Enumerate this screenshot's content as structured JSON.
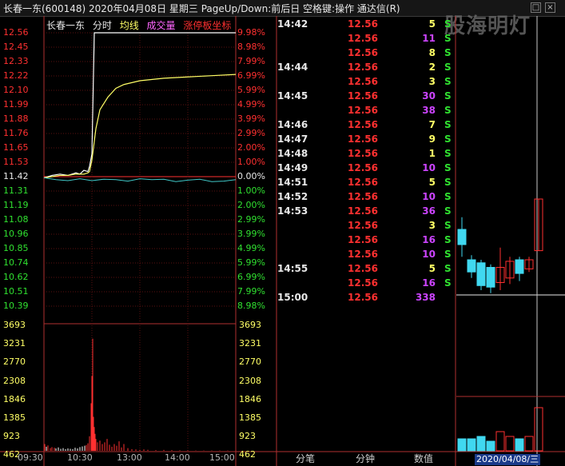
{
  "window": {
    "title": "长春一东(600148)  2020年04月08日 星期三  PageUp/Down:前后日  空格键:操作  通达信(R)",
    "min_glyph": "□",
    "close_glyph": "×"
  },
  "watermark": "股海明灯",
  "chart_header": {
    "name": "长春一东",
    "fenshi": "分时",
    "avg": "均线",
    "vol": "成交量",
    "limit": "涨停板坐标"
  },
  "colors": {
    "up": "#ff3030",
    "down": "#30e030",
    "neutral": "#e8e8e8",
    "price_line": "#ffffff",
    "avg_line": "#ffff66",
    "vol_axis": "#ffff66",
    "vol_large": "#cc44ff",
    "vol_small": "#ffff66",
    "candle_up": "#ff3030",
    "candle_down": "#40d8f0"
  },
  "chart_data": {
    "type": "line",
    "price_ticks": [
      "12.56",
      "12.45",
      "12.33",
      "12.22",
      "12.10",
      "11.99",
      "11.88",
      "11.76",
      "11.65",
      "11.53",
      "11.42",
      "11.31",
      "11.19",
      "11.08",
      "10.96",
      "10.85",
      "10.74",
      "10.62",
      "10.51",
      "10.39"
    ],
    "pct_ticks": [
      "9.98%",
      "8.98%",
      "7.99%",
      "6.99%",
      "5.99%",
      "4.99%",
      "3.99%",
      "2.99%",
      "2.00%",
      "1.00%",
      "0.00%",
      "1.00%",
      "2.00%",
      "2.99%",
      "3.99%",
      "4.99%",
      "5.99%",
      "6.99%",
      "7.99%",
      "8.98%"
    ],
    "vol_ticks": [
      "3693",
      "3231",
      "2770",
      "2308",
      "1846",
      "1385",
      "923",
      "462"
    ],
    "time_labels": [
      "09:30",
      "10:30",
      "13:00",
      "14:00",
      "15:00"
    ],
    "ylim": [
      10.28,
      12.56
    ],
    "prev_close": 11.42,
    "price_x": [
      0,
      10,
      20,
      30,
      40,
      45,
      50,
      55,
      57,
      60,
      63,
      65,
      70,
      80,
      90,
      100,
      120,
      150,
      180,
      210,
      240
    ],
    "price_y": [
      11.41,
      11.43,
      11.44,
      11.43,
      11.45,
      11.44,
      11.47,
      11.46,
      11.5,
      11.6,
      12.56,
      12.56,
      12.56,
      12.56,
      12.56,
      12.56,
      12.56,
      12.56,
      12.56,
      12.56,
      12.56
    ],
    "avg_x": [
      0,
      10,
      20,
      30,
      40,
      50,
      55,
      57,
      60,
      63,
      65,
      70,
      80,
      90,
      100,
      120,
      150,
      180,
      210,
      240
    ],
    "avg_y": [
      11.41,
      11.42,
      11.43,
      11.43,
      11.44,
      11.44,
      11.45,
      11.46,
      11.55,
      11.7,
      11.8,
      11.95,
      12.05,
      12.12,
      12.15,
      12.18,
      12.2,
      12.21,
      12.22,
      12.23
    ],
    "avg_pct_x": [
      0,
      15,
      30,
      45,
      60,
      75,
      90,
      105,
      120,
      135,
      150,
      165,
      180,
      195,
      210,
      225,
      240
    ],
    "avg_pct": [
      0.3,
      0.1,
      0.0,
      0.2,
      0.0,
      0.15,
      0.1,
      -0.05,
      0.2,
      0.1,
      0.15,
      -0.1,
      0.05,
      0.15,
      -0.1,
      -0.05,
      0.1
    ],
    "vol_ylim": [
      0,
      3693
    ],
    "volume": [
      [
        1,
        200
      ],
      [
        3,
        120
      ],
      [
        5,
        160
      ],
      [
        8,
        80
      ],
      [
        10,
        110
      ],
      [
        13,
        90
      ],
      [
        15,
        70
      ],
      [
        18,
        100
      ],
      [
        21,
        60
      ],
      [
        24,
        80
      ],
      [
        27,
        50
      ],
      [
        30,
        70
      ],
      [
        33,
        60
      ],
      [
        36,
        50
      ],
      [
        39,
        90
      ],
      [
        42,
        70
      ],
      [
        45,
        110
      ],
      [
        48,
        130
      ],
      [
        51,
        150
      ],
      [
        53,
        170
      ],
      [
        55,
        220
      ],
      [
        57,
        430
      ],
      [
        59,
        1400
      ],
      [
        60,
        2200
      ],
      [
        61,
        3300
      ],
      [
        62,
        1000
      ],
      [
        63,
        700
      ],
      [
        64,
        500
      ],
      [
        65,
        350
      ],
      [
        67,
        250
      ],
      [
        70,
        300
      ],
      [
        73,
        200
      ],
      [
        76,
        250
      ],
      [
        79,
        350
      ],
      [
        82,
        180
      ],
      [
        85,
        120
      ],
      [
        88,
        200
      ],
      [
        91,
        150
      ],
      [
        94,
        280
      ],
      [
        97,
        100
      ],
      [
        100,
        200
      ],
      [
        105,
        80
      ],
      [
        110,
        50
      ],
      [
        115,
        40
      ],
      [
        120,
        30
      ],
      [
        125,
        40
      ],
      [
        130,
        30
      ],
      [
        140,
        20
      ],
      [
        150,
        25
      ],
      [
        160,
        20
      ],
      [
        170,
        15
      ],
      [
        180,
        15
      ],
      [
        190,
        10
      ],
      [
        200,
        10
      ],
      [
        210,
        10
      ],
      [
        220,
        10
      ],
      [
        230,
        8
      ],
      [
        240,
        8
      ]
    ]
  },
  "ticks": [
    {
      "time": "14:42",
      "price": "12.56",
      "vol": "5",
      "vc": "small",
      "flag": "S"
    },
    {
      "time": "",
      "price": "12.56",
      "vol": "11",
      "vc": "large",
      "flag": "S"
    },
    {
      "time": "",
      "price": "12.56",
      "vol": "8",
      "vc": "small",
      "flag": "S"
    },
    {
      "time": "14:44",
      "price": "12.56",
      "vol": "2",
      "vc": "small",
      "flag": "S"
    },
    {
      "time": "",
      "price": "12.56",
      "vol": "3",
      "vc": "small",
      "flag": "S"
    },
    {
      "time": "14:45",
      "price": "12.56",
      "vol": "30",
      "vc": "large",
      "flag": "S"
    },
    {
      "time": "",
      "price": "12.56",
      "vol": "38",
      "vc": "large",
      "flag": "S"
    },
    {
      "time": "14:46",
      "price": "12.56",
      "vol": "7",
      "vc": "small",
      "flag": "S"
    },
    {
      "time": "14:47",
      "price": "12.56",
      "vol": "9",
      "vc": "small",
      "flag": "S"
    },
    {
      "time": "14:48",
      "price": "12.56",
      "vol": "1",
      "vc": "small",
      "flag": "S"
    },
    {
      "time": "14:49",
      "price": "12.56",
      "vol": "10",
      "vc": "large",
      "flag": "S"
    },
    {
      "time": "14:51",
      "price": "12.56",
      "vol": "5",
      "vc": "small",
      "flag": "S"
    },
    {
      "time": "14:52",
      "price": "12.56",
      "vol": "10",
      "vc": "large",
      "flag": "S"
    },
    {
      "time": "14:53",
      "price": "12.56",
      "vol": "36",
      "vc": "large",
      "flag": "S"
    },
    {
      "time": "",
      "price": "12.56",
      "vol": "3",
      "vc": "small",
      "flag": "S"
    },
    {
      "time": "",
      "price": "12.56",
      "vol": "16",
      "vc": "large",
      "flag": "S"
    },
    {
      "time": "",
      "price": "12.56",
      "vol": "10",
      "vc": "large",
      "flag": "S"
    },
    {
      "time": "14:55",
      "price": "12.56",
      "vol": "5",
      "vc": "small",
      "flag": "S"
    },
    {
      "time": "",
      "price": "12.56",
      "vol": "16",
      "vc": "large",
      "flag": "S"
    },
    {
      "time": "15:00",
      "price": "12.56",
      "vol": "338",
      "vc": "large",
      "flag": ""
    }
  ],
  "tabs": [
    "分笔",
    "分钟",
    "数值"
  ],
  "kline": {
    "date_label": "2020/04/08/三",
    "candles": [
      {
        "dir": "down",
        "o": 0.7,
        "c": 0.6,
        "h": 0.78,
        "l": 0.52
      },
      {
        "dir": "down",
        "o": 0.5,
        "c": 0.42,
        "h": 0.53,
        "l": 0.38
      },
      {
        "dir": "down",
        "o": 0.48,
        "c": 0.33,
        "h": 0.5,
        "l": 0.3
      },
      {
        "dir": "down",
        "o": 0.45,
        "c": 0.32,
        "h": 0.47,
        "l": 0.28
      },
      {
        "dir": "up",
        "o": 0.35,
        "c": 0.45,
        "h": 0.58,
        "l": 0.3
      },
      {
        "dir": "up",
        "o": 0.38,
        "c": 0.49,
        "h": 0.52,
        "l": 0.34
      },
      {
        "dir": "down",
        "o": 0.5,
        "c": 0.41,
        "h": 0.52,
        "l": 0.36
      },
      {
        "dir": "up",
        "o": 0.44,
        "c": 0.5,
        "h": 0.52,
        "l": 0.42
      },
      {
        "dir": "up",
        "o": 0.56,
        "c": 0.9,
        "h": 0.9,
        "l": 0.56
      }
    ],
    "volumes": [
      0.25,
      0.25,
      0.3,
      0.2,
      0.4,
      0.3,
      0.25,
      0.3,
      0.9
    ]
  }
}
